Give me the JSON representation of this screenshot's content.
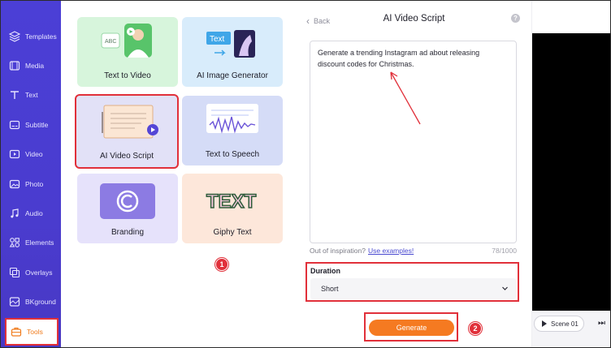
{
  "sidebar": {
    "items": [
      {
        "label": "Templates",
        "icon": "layers-icon"
      },
      {
        "label": "Media",
        "icon": "media-icon"
      },
      {
        "label": "Text",
        "icon": "text-icon"
      },
      {
        "label": "Subtitle",
        "icon": "subtitle-icon"
      },
      {
        "label": "Video",
        "icon": "video-icon"
      },
      {
        "label": "Photo",
        "icon": "photo-icon"
      },
      {
        "label": "Audio",
        "icon": "music-icon"
      },
      {
        "label": "Elements",
        "icon": "elements-icon"
      },
      {
        "label": "Overlays",
        "icon": "overlays-icon"
      },
      {
        "label": "BKground",
        "icon": "background-icon"
      },
      {
        "label": "Tools",
        "icon": "toolbox-icon",
        "active": true
      }
    ]
  },
  "tools": {
    "cards": [
      {
        "label": "Text to Video"
      },
      {
        "label": "AI Image Generator",
        "art_text": "Text"
      },
      {
        "label": "AI Video Script"
      },
      {
        "label": "Text to Speech"
      },
      {
        "label": "Branding"
      },
      {
        "label": "Giphy Text",
        "art_text": "TEXT"
      }
    ],
    "step_badge": "1",
    "ttv_art_text": "ABC"
  },
  "script_panel": {
    "back_label": "Back",
    "title": "AI Video Script",
    "help_icon": "?",
    "prompt_text": "Generate a trending Instagram ad about releasing discount codes for Christmas.",
    "inspiration_text": "Out of inspiration?",
    "examples_link": "Use examples!",
    "char_count": "78/1000",
    "duration_label": "Duration",
    "duration_value": "Short",
    "generate_label": "Generate",
    "step_badge": "2"
  },
  "preview": {
    "scene_label": "Scene 01",
    "next_glyph": "⏭"
  },
  "colors": {
    "sidebar": "#4a3ccf",
    "accent_orange": "#f57a21",
    "highlight_red": "#e1303a"
  }
}
